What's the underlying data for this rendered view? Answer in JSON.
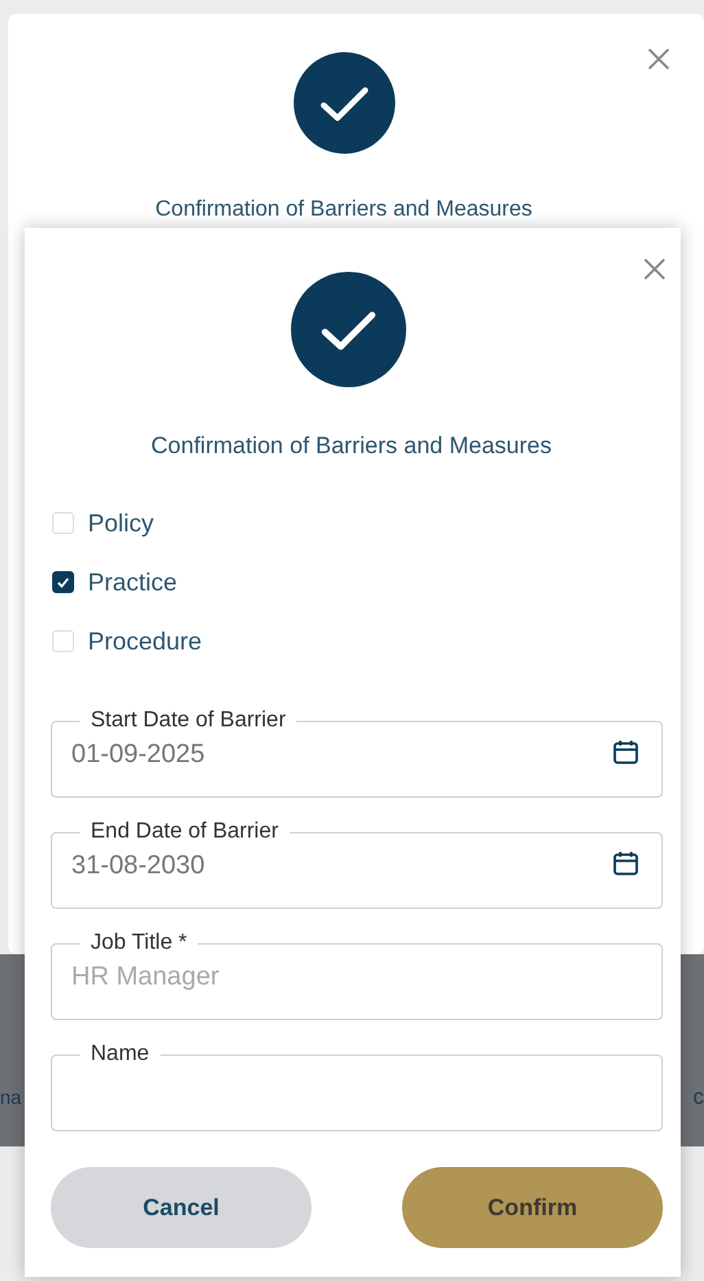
{
  "background_dialog": {
    "title": "Confirmation of Barriers and Measures",
    "footer_fragments": [
      "na",
      "c"
    ]
  },
  "dialog": {
    "title": "Confirmation of Barriers and Measures",
    "options": [
      {
        "label": "Policy",
        "checked": false
      },
      {
        "label": "Practice",
        "checked": true
      },
      {
        "label": "Procedure",
        "checked": false
      }
    ],
    "fields": [
      {
        "label": "Start Date of Barrier",
        "value": "01-09-2025",
        "kind": "date"
      },
      {
        "label": "End Date of Barrier",
        "value": "31-08-2030",
        "kind": "date"
      },
      {
        "label": "Job Title *",
        "placeholder": "HR Manager",
        "kind": "text"
      },
      {
        "label": "Name",
        "kind": "text"
      }
    ],
    "buttons": [
      {
        "label": "Cancel",
        "kind": "secondary"
      },
      {
        "label": "Confirm",
        "kind": "primary"
      }
    ]
  }
}
